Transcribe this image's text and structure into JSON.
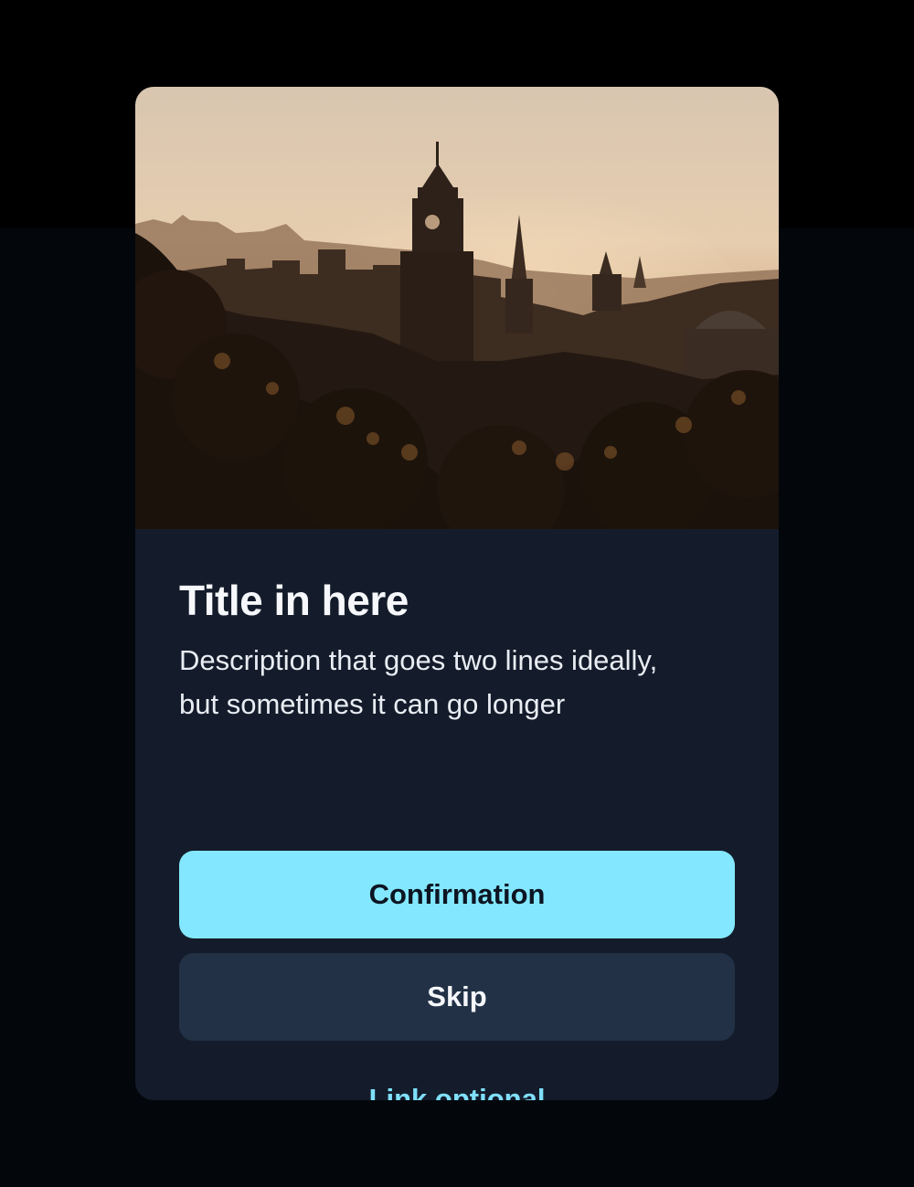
{
  "dialog": {
    "title": "Title in here",
    "description_line1": "Description that goes two lines ideally,",
    "description_line2": "but sometimes it can go longer",
    "primary_button_label": "Confirmation",
    "secondary_button_label": "Skip",
    "link_label": "Link optional"
  },
  "colors": {
    "card_background": "#141c2b",
    "primary_button": "#83e8ff",
    "secondary_button": "#223146",
    "link": "#7fe0fb"
  }
}
